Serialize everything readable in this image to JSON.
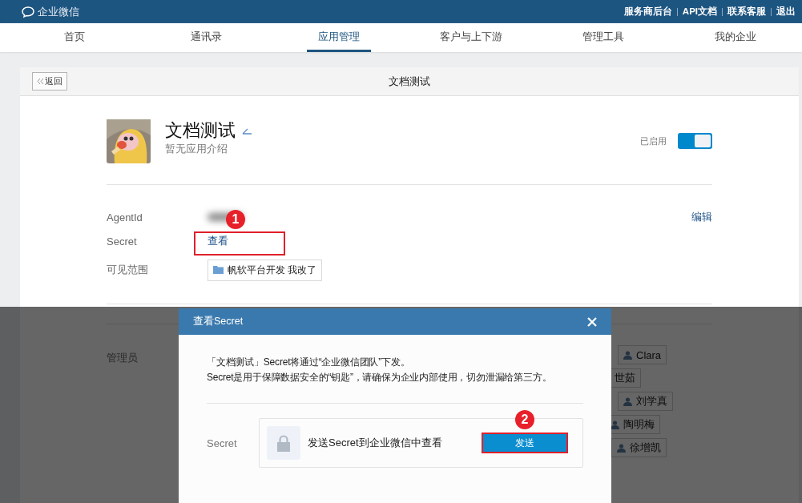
{
  "top_bar": {
    "logo": "企业微信",
    "links": [
      "服务商后台",
      "API文档",
      "联系客服",
      "退出"
    ]
  },
  "nav": [
    {
      "label": "首页",
      "selected": false
    },
    {
      "label": "通讯录",
      "selected": false
    },
    {
      "label": "应用管理",
      "selected": true
    },
    {
      "label": "客户与上下游",
      "selected": false
    },
    {
      "label": "管理工具",
      "selected": false
    },
    {
      "label": "我的企业",
      "selected": false
    }
  ],
  "page": {
    "back_button": "返回",
    "title": "文档测试"
  },
  "app": {
    "name": "文档测试",
    "description": "暂无应用介绍",
    "status_label": "已启用",
    "enabled": true
  },
  "details": {
    "edit_link": "编辑",
    "rows": [
      {
        "label": "AgentId",
        "kind": "hidden"
      },
      {
        "label": "Secret",
        "kind": "link",
        "value": "查看",
        "annotation": "1"
      },
      {
        "label": "可见范围",
        "kind": "tag",
        "value": "帆软平台开发 我改了"
      }
    ]
  },
  "admins": {
    "label": "管理员",
    "members": [
      "Clara",
      "世茹",
      "刘学真",
      "陶明梅",
      "徐增凯"
    ]
  },
  "dialog": {
    "title": "查看Secret",
    "lines": [
      "「文档测试」Secret将通过“企业微信团队”下发。",
      "Secret是用于保障数据安全的“钥匙”，请确保为企业内部使用，切勿泄漏给第三方。"
    ],
    "field_label": "Secret",
    "prompt": "发送Secret到企业微信中查看",
    "send_button": "发送",
    "annotation": "2"
  }
}
